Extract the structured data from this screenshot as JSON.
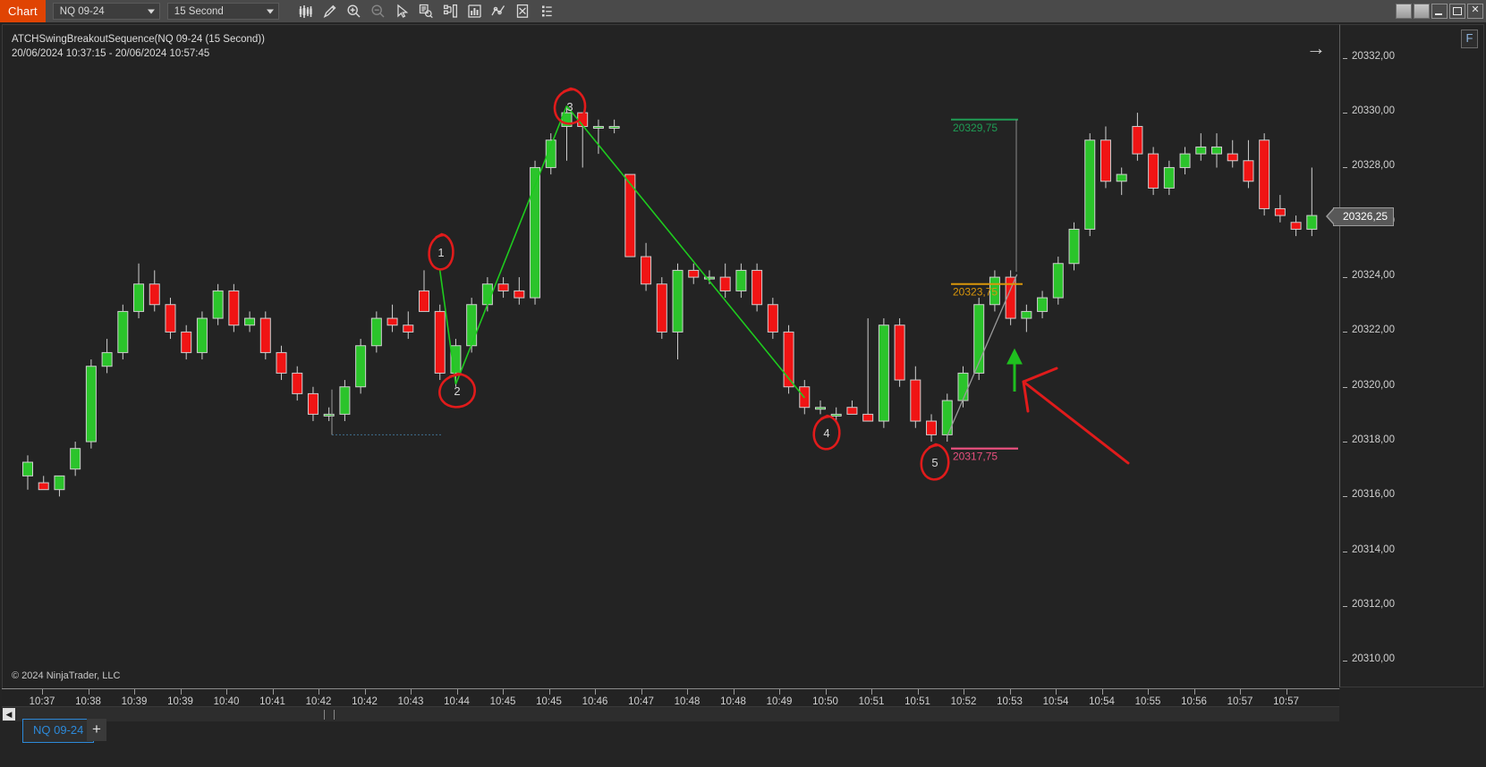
{
  "window": {
    "app_badge": "Chart",
    "controls": [
      "restore-square",
      "restore-square",
      "minimize",
      "maximize",
      "close"
    ],
    "close_glyph": "✕"
  },
  "toolbar": {
    "instrument": {
      "value": "NQ 09-24",
      "label": "instrument-selector"
    },
    "interval": {
      "value": "15 Second",
      "label": "interval-selector"
    },
    "buttons": [
      {
        "name": "bar-type-icon",
        "title": "Bar Type"
      },
      {
        "name": "drawing-pencil-icon",
        "title": "Drawing Tools"
      },
      {
        "name": "zoom-in-icon",
        "title": "Zoom In"
      },
      {
        "name": "zoom-out-icon",
        "title": "Zoom Out"
      },
      {
        "name": "cursor-pointer-icon",
        "title": "Pointer"
      },
      {
        "name": "data-series-icon",
        "title": "Data Series"
      },
      {
        "name": "chart-properties-icon",
        "title": "Properties"
      },
      {
        "name": "indicators-icon",
        "title": "Indicators"
      },
      {
        "name": "strategies-icon",
        "title": "Strategies"
      },
      {
        "name": "templates-icon",
        "title": "Templates"
      },
      {
        "name": "more-options-icon",
        "title": "More"
      }
    ]
  },
  "chart": {
    "title": "ATCHSwingBreakoutSequence(NQ 09-24 (15 Second))",
    "subtitle": "20/06/2024 10:37:15 - 20/06/2024 10:57:45",
    "copyright": "© 2024 NinjaTrader, LLC",
    "scroll_right_glyph": "→",
    "f_button": "F",
    "last_price": "20326,25"
  },
  "price_axis": {
    "ticks": [
      "20332,00",
      "20330,00",
      "20328,00",
      "20326,00",
      "20324,00",
      "20322,00",
      "20320,00",
      "20318,00",
      "20316,00",
      "20314,00",
      "20312,00",
      "20310,00"
    ]
  },
  "time_axis": {
    "ticks": [
      "10:37",
      "10:38",
      "10:39",
      "10:39",
      "10:40",
      "10:41",
      "10:42",
      "10:42",
      "10:43",
      "10:44",
      "10:45",
      "10:45",
      "10:46",
      "10:47",
      "10:48",
      "10:48",
      "10:49",
      "10:50",
      "10:51",
      "10:51",
      "10:52",
      "10:53",
      "10:54",
      "10:54",
      "10:55",
      "10:56",
      "10:57",
      "10:57"
    ]
  },
  "levels": [
    {
      "name": "target-line",
      "value": "20329,75",
      "color": "#1f9d55"
    },
    {
      "name": "entry-line",
      "value": "20323,75",
      "color": "#d9960b"
    },
    {
      "name": "stop-line",
      "value": "20317,75",
      "color": "#e8507e"
    }
  ],
  "annotations": {
    "circles": [
      "1",
      "2",
      "3",
      "4",
      "5"
    ],
    "arrow_color": "#e01b1b",
    "circle_color": "#e01b1b"
  },
  "bottom": {
    "tab_label": "NQ 09-24",
    "add_tab": "+",
    "scroll_left_glyph": "◀"
  },
  "colors": {
    "accent": "#e04403",
    "bullish": "#2bc42b",
    "bearish": "#f01414",
    "background": "#232323",
    "toolbar": "#4a4a4a",
    "tab_blue": "#2c89d9"
  },
  "chart_data": {
    "type": "candlestick",
    "title": "ATCHSwingBreakoutSequence(NQ 09-24 (15 Second))",
    "xlabel": "",
    "ylabel": "",
    "ylim": [
      20309.0,
      20333.2
    ],
    "grid": false,
    "legend": "none",
    "instrument": "NQ 09-24",
    "interval": "15 Second",
    "session": "20/06/2024 10:37:15 - 20/06/2024 10:57:45",
    "bars": [
      {
        "t": "10:37:15",
        "o": 20316.75,
        "h": 20317.5,
        "l": 20316.25,
        "c": 20317.25,
        "d": "up"
      },
      {
        "t": "10:37:30",
        "o": 20316.5,
        "h": 20316.75,
        "l": 20316.25,
        "c": 20316.25,
        "d": "down"
      },
      {
        "t": "10:37:45",
        "o": 20316.25,
        "h": 20316.75,
        "l": 20316.0,
        "c": 20316.75,
        "d": "up"
      },
      {
        "t": "10:38:00",
        "o": 20317.0,
        "h": 20318.0,
        "l": 20316.75,
        "c": 20317.75,
        "d": "up"
      },
      {
        "t": "10:38:15",
        "o": 20318.0,
        "h": 20321.0,
        "l": 20317.75,
        "c": 20320.75,
        "d": "up"
      },
      {
        "t": "10:38:30",
        "o": 20320.75,
        "h": 20321.75,
        "l": 20320.5,
        "c": 20321.25,
        "d": "up"
      },
      {
        "t": "10:38:45",
        "o": 20321.25,
        "h": 20323.0,
        "l": 20321.0,
        "c": 20322.75,
        "d": "up"
      },
      {
        "t": "10:39:00",
        "o": 20322.75,
        "h": 20324.5,
        "l": 20322.5,
        "c": 20323.75,
        "d": "up"
      },
      {
        "t": "10:39:15",
        "o": 20323.75,
        "h": 20324.25,
        "l": 20322.75,
        "c": 20323.0,
        "d": "down"
      },
      {
        "t": "10:39:30",
        "o": 20323.0,
        "h": 20323.25,
        "l": 20321.75,
        "c": 20322.0,
        "d": "down"
      },
      {
        "t": "10:39:45",
        "o": 20322.0,
        "h": 20322.25,
        "l": 20321.0,
        "c": 20321.25,
        "d": "down"
      },
      {
        "t": "10:40:00",
        "o": 20321.25,
        "h": 20322.75,
        "l": 20321.0,
        "c": 20322.5,
        "d": "up"
      },
      {
        "t": "10:40:15",
        "o": 20322.5,
        "h": 20323.75,
        "l": 20322.25,
        "c": 20323.5,
        "d": "up"
      },
      {
        "t": "10:40:30",
        "o": 20323.5,
        "h": 20323.75,
        "l": 20322.0,
        "c": 20322.25,
        "d": "down"
      },
      {
        "t": "10:40:45",
        "o": 20322.25,
        "h": 20322.75,
        "l": 20322.0,
        "c": 20322.5,
        "d": "up"
      },
      {
        "t": "10:41:00",
        "o": 20322.5,
        "h": 20322.75,
        "l": 20321.0,
        "c": 20321.25,
        "d": "down"
      },
      {
        "t": "10:41:15",
        "o": 20321.25,
        "h": 20321.5,
        "l": 20320.25,
        "c": 20320.5,
        "d": "down"
      },
      {
        "t": "10:41:30",
        "o": 20320.5,
        "h": 20320.75,
        "l": 20319.5,
        "c": 20319.75,
        "d": "down"
      },
      {
        "t": "10:41:45",
        "o": 20319.75,
        "h": 20320.0,
        "l": 20318.75,
        "c": 20319.0,
        "d": "down"
      },
      {
        "t": "10:42:00",
        "o": 20319.0,
        "h": 20319.25,
        "l": 20318.75,
        "c": 20319.0,
        "d": "up"
      },
      {
        "t": "10:42:15",
        "o": 20319.0,
        "h": 20320.25,
        "l": 20318.75,
        "c": 20320.0,
        "d": "up"
      },
      {
        "t": "10:42:30",
        "o": 20320.0,
        "h": 20321.75,
        "l": 20319.75,
        "c": 20321.5,
        "d": "up"
      },
      {
        "t": "10:42:45",
        "o": 20321.5,
        "h": 20322.75,
        "l": 20321.25,
        "c": 20322.5,
        "d": "up"
      },
      {
        "t": "10:43:00",
        "o": 20322.5,
        "h": 20323.0,
        "l": 20322.0,
        "c": 20322.25,
        "d": "down"
      },
      {
        "t": "10:43:15",
        "o": 20322.25,
        "h": 20322.75,
        "l": 20321.75,
        "c": 20322.0,
        "d": "down"
      },
      {
        "t": "10:43:30",
        "o": 20323.5,
        "h": 20324.25,
        "l": 20322.75,
        "c": 20322.75,
        "d": "down"
      },
      {
        "t": "10:43:45",
        "o": 20322.75,
        "h": 20323.0,
        "l": 20320.25,
        "c": 20320.5,
        "d": "down"
      },
      {
        "t": "10:44:00",
        "o": 20320.5,
        "h": 20321.75,
        "l": 20320.0,
        "c": 20321.5,
        "d": "up"
      },
      {
        "t": "10:44:15",
        "o": 20321.5,
        "h": 20323.25,
        "l": 20321.25,
        "c": 20323.0,
        "d": "up"
      },
      {
        "t": "10:44:30",
        "o": 20323.0,
        "h": 20324.0,
        "l": 20322.75,
        "c": 20323.75,
        "d": "up"
      },
      {
        "t": "10:44:45",
        "o": 20323.75,
        "h": 20324.0,
        "l": 20323.25,
        "c": 20323.5,
        "d": "down"
      },
      {
        "t": "10:45:00",
        "o": 20323.5,
        "h": 20324.0,
        "l": 20323.0,
        "c": 20323.25,
        "d": "down"
      },
      {
        "t": "10:45:15",
        "o": 20323.25,
        "h": 20328.25,
        "l": 20323.0,
        "c": 20328.0,
        "d": "up"
      },
      {
        "t": "10:45:30",
        "o": 20328.0,
        "h": 20329.25,
        "l": 20327.75,
        "c": 20329.0,
        "d": "up"
      },
      {
        "t": "10:45:45",
        "o": 20329.5,
        "h": 20330.25,
        "l": 20328.25,
        "c": 20330.0,
        "d": "up"
      },
      {
        "t": "10:46:00",
        "o": 20330.0,
        "h": 20330.0,
        "l": 20328.0,
        "c": 20329.5,
        "d": "down"
      },
      {
        "t": "10:46:15",
        "o": 20329.5,
        "h": 20329.75,
        "l": 20328.5,
        "c": 20329.5,
        "d": "up"
      },
      {
        "t": "10:46:30",
        "o": 20329.5,
        "h": 20329.75,
        "l": 20329.25,
        "c": 20329.5,
        "d": "up"
      },
      {
        "t": "10:46:45",
        "o": 20327.75,
        "h": 20327.75,
        "l": 20324.75,
        "c": 20324.75,
        "d": "down"
      },
      {
        "t": "10:47:00",
        "o": 20324.75,
        "h": 20325.25,
        "l": 20323.5,
        "c": 20323.75,
        "d": "down"
      },
      {
        "t": "10:47:15",
        "o": 20323.75,
        "h": 20324.0,
        "l": 20321.75,
        "c": 20322.0,
        "d": "down"
      },
      {
        "t": "10:47:30",
        "o": 20322.0,
        "h": 20324.5,
        "l": 20321.0,
        "c": 20324.25,
        "d": "up"
      },
      {
        "t": "10:47:45",
        "o": 20324.25,
        "h": 20324.5,
        "l": 20323.75,
        "c": 20324.0,
        "d": "down"
      },
      {
        "t": "10:48:00",
        "o": 20324.0,
        "h": 20324.25,
        "l": 20323.75,
        "c": 20324.0,
        "d": "up"
      },
      {
        "t": "10:48:15",
        "o": 20324.0,
        "h": 20324.5,
        "l": 20323.25,
        "c": 20323.5,
        "d": "down"
      },
      {
        "t": "10:48:30",
        "o": 20323.5,
        "h": 20324.5,
        "l": 20323.25,
        "c": 20324.25,
        "d": "up"
      },
      {
        "t": "10:48:45",
        "o": 20324.25,
        "h": 20324.5,
        "l": 20322.75,
        "c": 20323.0,
        "d": "down"
      },
      {
        "t": "10:49:00",
        "o": 20323.0,
        "h": 20323.25,
        "l": 20321.75,
        "c": 20322.0,
        "d": "down"
      },
      {
        "t": "10:49:15",
        "o": 20322.0,
        "h": 20322.25,
        "l": 20319.75,
        "c": 20320.0,
        "d": "down"
      },
      {
        "t": "10:49:30",
        "o": 20320.0,
        "h": 20320.25,
        "l": 20319.0,
        "c": 20319.25,
        "d": "down"
      },
      {
        "t": "10:49:45",
        "o": 20319.25,
        "h": 20319.5,
        "l": 20319.0,
        "c": 20319.25,
        "d": "up"
      },
      {
        "t": "10:50:00",
        "o": 20319.0,
        "h": 20319.25,
        "l": 20318.75,
        "c": 20319.0,
        "d": "up"
      },
      {
        "t": "10:50:15",
        "o": 20319.25,
        "h": 20319.5,
        "l": 20319.0,
        "c": 20319.0,
        "d": "down"
      },
      {
        "t": "10:50:30",
        "o": 20319.0,
        "h": 20322.5,
        "l": 20318.75,
        "c": 20318.75,
        "d": "down"
      },
      {
        "t": "10:50:45",
        "o": 20318.75,
        "h": 20322.5,
        "l": 20318.5,
        "c": 20322.25,
        "d": "up"
      },
      {
        "t": "10:51:00",
        "o": 20322.25,
        "h": 20322.5,
        "l": 20320.0,
        "c": 20320.25,
        "d": "down"
      },
      {
        "t": "10:51:15",
        "o": 20320.25,
        "h": 20320.75,
        "l": 20318.5,
        "c": 20318.75,
        "d": "down"
      },
      {
        "t": "10:51:30",
        "o": 20318.75,
        "h": 20319.0,
        "l": 20318.0,
        "c": 20318.25,
        "d": "down"
      },
      {
        "t": "10:51:45",
        "o": 20318.25,
        "h": 20319.75,
        "l": 20318.0,
        "c": 20319.5,
        "d": "up"
      },
      {
        "t": "10:52:00",
        "o": 20319.5,
        "h": 20320.75,
        "l": 20319.25,
        "c": 20320.5,
        "d": "up"
      },
      {
        "t": "10:52:15",
        "o": 20320.5,
        "h": 20323.25,
        "l": 20320.25,
        "c": 20323.0,
        "d": "up"
      },
      {
        "t": "10:52:30",
        "o": 20323.0,
        "h": 20324.25,
        "l": 20322.75,
        "c": 20324.0,
        "d": "up"
      },
      {
        "t": "10:52:45",
        "o": 20324.0,
        "h": 20324.25,
        "l": 20322.25,
        "c": 20322.5,
        "d": "down"
      },
      {
        "t": "10:53:00",
        "o": 20322.5,
        "h": 20323.0,
        "l": 20322.0,
        "c": 20322.75,
        "d": "up"
      },
      {
        "t": "10:53:15",
        "o": 20322.75,
        "h": 20323.5,
        "l": 20322.5,
        "c": 20323.25,
        "d": "up"
      },
      {
        "t": "10:53:30",
        "o": 20323.25,
        "h": 20324.75,
        "l": 20323.0,
        "c": 20324.5,
        "d": "up"
      },
      {
        "t": "10:53:45",
        "o": 20324.5,
        "h": 20326.0,
        "l": 20324.25,
        "c": 20325.75,
        "d": "up"
      },
      {
        "t": "10:54:00",
        "o": 20325.75,
        "h": 20329.25,
        "l": 20325.5,
        "c": 20329.0,
        "d": "up"
      },
      {
        "t": "10:54:15",
        "o": 20329.0,
        "h": 20329.5,
        "l": 20327.25,
        "c": 20327.5,
        "d": "down"
      },
      {
        "t": "10:54:30",
        "o": 20327.5,
        "h": 20328.0,
        "l": 20327.0,
        "c": 20327.75,
        "d": "up"
      },
      {
        "t": "10:54:45",
        "o": 20329.5,
        "h": 20330.0,
        "l": 20328.25,
        "c": 20328.5,
        "d": "down"
      },
      {
        "t": "10:55:00",
        "o": 20328.5,
        "h": 20328.75,
        "l": 20327.0,
        "c": 20327.25,
        "d": "down"
      },
      {
        "t": "10:55:15",
        "o": 20327.25,
        "h": 20328.25,
        "l": 20327.0,
        "c": 20328.0,
        "d": "up"
      },
      {
        "t": "10:55:30",
        "o": 20328.0,
        "h": 20328.75,
        "l": 20327.75,
        "c": 20328.5,
        "d": "up"
      },
      {
        "t": "10:55:45",
        "o": 20328.5,
        "h": 20329.25,
        "l": 20328.25,
        "c": 20328.75,
        "d": "up"
      },
      {
        "t": "10:56:00",
        "o": 20328.75,
        "h": 20329.25,
        "l": 20328.0,
        "c": 20328.5,
        "d": "up"
      },
      {
        "t": "10:56:15",
        "o": 20328.5,
        "h": 20329.0,
        "l": 20328.0,
        "c": 20328.25,
        "d": "down"
      },
      {
        "t": "10:56:30",
        "o": 20328.25,
        "h": 20329.0,
        "l": 20327.25,
        "c": 20327.5,
        "d": "down"
      },
      {
        "t": "10:56:45",
        "o": 20329.0,
        "h": 20329.25,
        "l": 20326.25,
        "c": 20326.5,
        "d": "down"
      },
      {
        "t": "10:57:00",
        "o": 20326.5,
        "h": 20327.0,
        "l": 20326.0,
        "c": 20326.25,
        "d": "down"
      },
      {
        "t": "10:57:15",
        "o": 20326.0,
        "h": 20326.25,
        "l": 20325.5,
        "c": 20325.75,
        "d": "down"
      },
      {
        "t": "10:57:30",
        "o": 20325.75,
        "h": 20328.0,
        "l": 20325.5,
        "c": 20326.25,
        "d": "up"
      }
    ],
    "swing_lines": [
      {
        "name": "swing-1-to-2",
        "from": "1",
        "to": "2",
        "color": "#22c522"
      },
      {
        "name": "swing-2-to-3",
        "from": "2",
        "to": "3",
        "color": "#22c522"
      },
      {
        "name": "swing-3-to-4",
        "from": "3",
        "to": "4",
        "color": "#22c522"
      }
    ]
  }
}
